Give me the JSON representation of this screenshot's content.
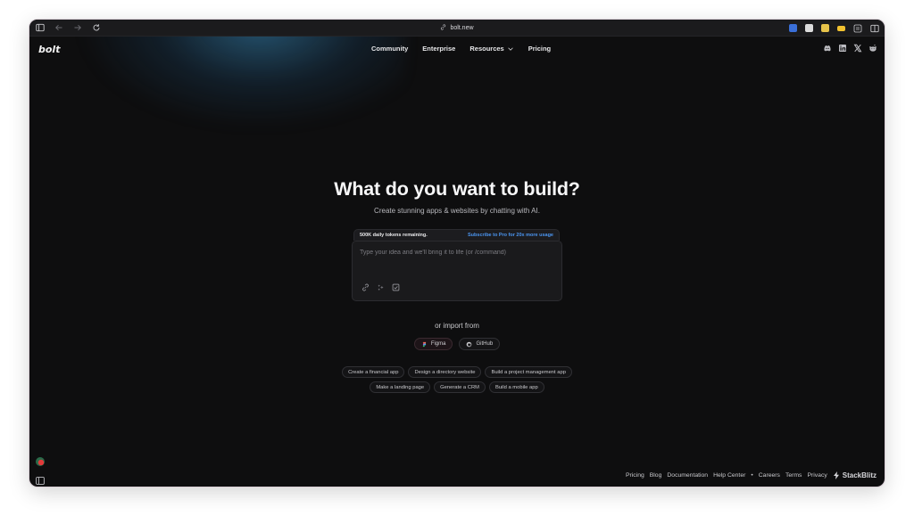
{
  "browser": {
    "url": "bolt.new",
    "icons": [
      "sidebar-icon",
      "back-arrow-icon",
      "forward-arrow-icon",
      "reload-icon"
    ],
    "extensions": [
      {
        "name": "bitwarden-extension-icon",
        "color": "#3a6fd8"
      },
      {
        "name": "screenshot-extension-icon",
        "color": "#dcdcdc"
      },
      {
        "name": "heart-extension-icon",
        "color": "#e6c34a"
      },
      {
        "name": "wallet-extension-icon",
        "color": "#f2c230"
      }
    ]
  },
  "header": {
    "logo": "bolt",
    "nav": {
      "community": "Community",
      "enterprise": "Enterprise",
      "resources": "Resources",
      "pricing": "Pricing"
    },
    "socials": [
      "discord-icon",
      "linkedin-icon",
      "x-icon",
      "reddit-icon"
    ]
  },
  "hero": {
    "title": "What do you want to build?",
    "subtitle": "Create stunning apps & websites by chatting with AI."
  },
  "tokens": {
    "remaining": "500K daily tokens remaining.",
    "upgrade": "Subscribe to Pro for 20x more usage"
  },
  "prompt": {
    "placeholder": "Type your idea and we'll bring it to life (or /command)"
  },
  "import": {
    "label": "or import from",
    "figma": "Figma",
    "github": "GitHub"
  },
  "suggestions": {
    "row1": [
      "Create a financial app",
      "Design a directory website",
      "Build a project management app"
    ],
    "row2": [
      "Make a landing page",
      "Generate a CRM",
      "Build a mobile app"
    ]
  },
  "footer": {
    "pricing": "Pricing",
    "blog": "Blog",
    "documentation": "Documentation",
    "help_center": "Help Center",
    "separator": "•",
    "careers": "Careers",
    "terms": "Terms",
    "privacy": "Privacy",
    "brand": "StackBlitz"
  },
  "colors": {
    "background": "#0e0e0f",
    "accent_link": "#4b95f0",
    "glow": "#388cbe"
  }
}
